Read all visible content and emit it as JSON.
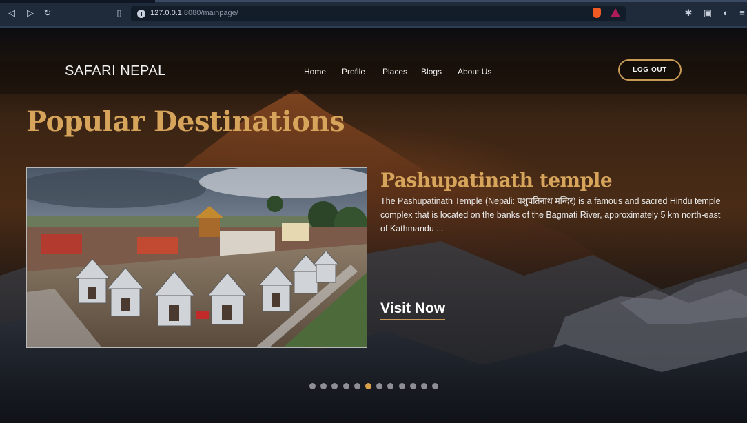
{
  "browser": {
    "url_host": "127.0.0.1",
    "url_rest": ":8080/mainpage/"
  },
  "site": {
    "brand": "SAFARI NEPAL",
    "nav": [
      "Home",
      "Profile",
      "Places",
      "Blogs",
      "About Us"
    ],
    "logout_label": "LOG OUT"
  },
  "hero": {
    "section_title": "Popular Destinations",
    "card_title": "Pashupatinath temple",
    "card_description": "The Pashupatinath Temple (Nepali: पशुपतिनाथ मन्दिर) is a famous and sacred Hindu temple complex that is located on the banks of the Bagmati River, approximately 5 km north-east of Kathmandu ...",
    "cta_label": "Visit Now",
    "slides_total": 12,
    "active_slide": 5
  },
  "colors": {
    "accent_gold": "#d6a45b",
    "active_dot": "#d8a14a",
    "inactive_dot": "#8d8f94"
  }
}
